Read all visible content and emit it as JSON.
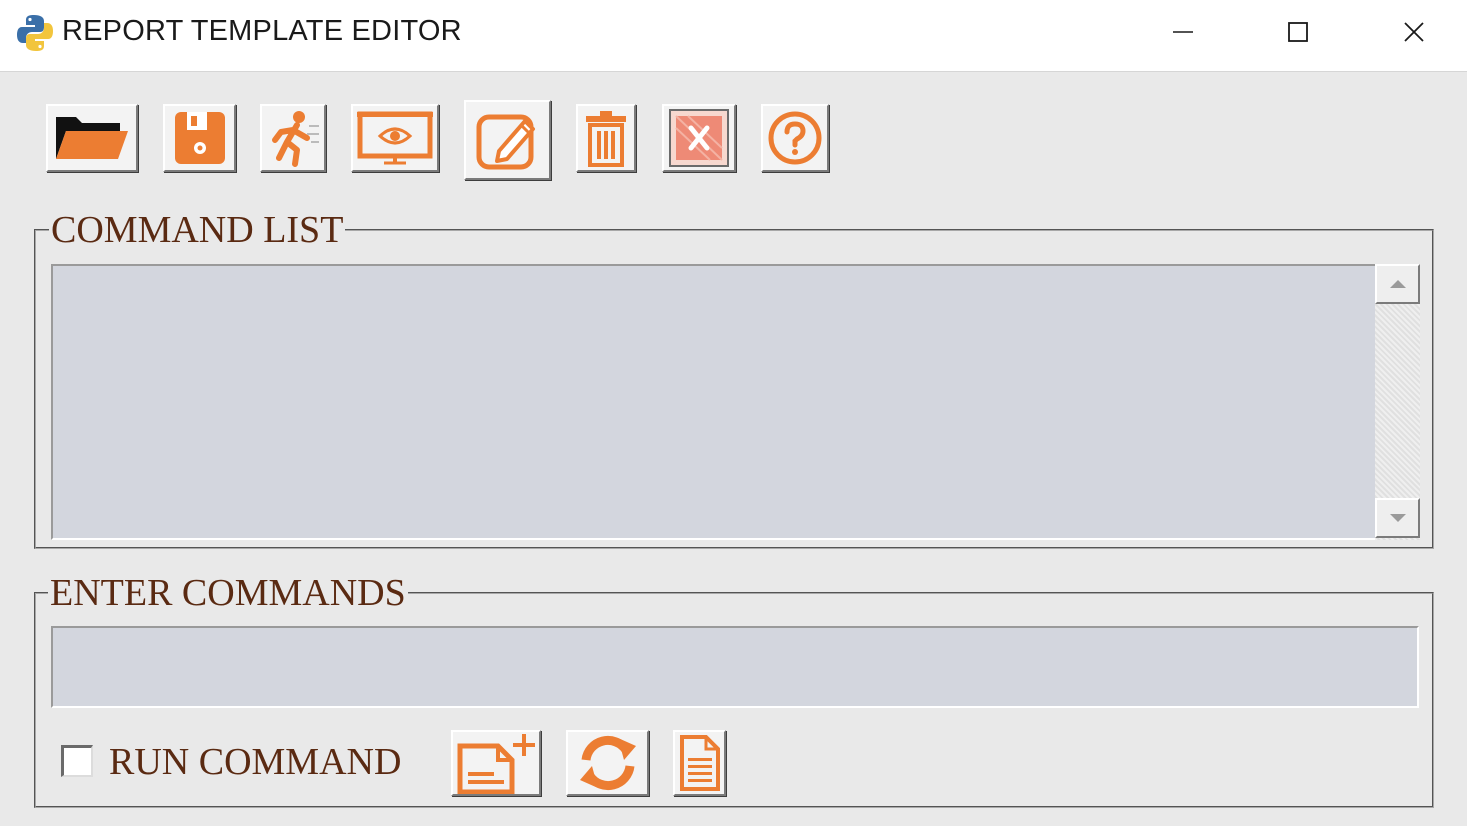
{
  "window": {
    "title": "REPORT TEMPLATE EDITOR",
    "controls": [
      "minimize",
      "maximize",
      "close"
    ]
  },
  "toolbar": {
    "buttons": [
      {
        "id": "open",
        "icon": "folder-open-icon"
      },
      {
        "id": "save",
        "icon": "floppy-disk-icon"
      },
      {
        "id": "run",
        "icon": "running-man-icon"
      },
      {
        "id": "preview",
        "icon": "screen-eye-icon"
      },
      {
        "id": "edit",
        "icon": "pencil-edit-icon"
      },
      {
        "id": "delete",
        "icon": "trash-can-icon"
      },
      {
        "id": "clear",
        "icon": "clear-x-icon"
      },
      {
        "id": "help",
        "icon": "question-mark-icon"
      }
    ]
  },
  "command_list": {
    "label": "COMMAND LIST",
    "items": []
  },
  "enter_commands": {
    "label": "ENTER COMMANDS",
    "value": "",
    "run_command_label": "RUN COMMAND",
    "run_command_checked": false,
    "buttons": [
      {
        "id": "add",
        "icon": "document-add-icon"
      },
      {
        "id": "refresh",
        "icon": "refresh-arrows-icon"
      },
      {
        "id": "view",
        "icon": "document-icon"
      }
    ]
  },
  "colors": {
    "accent": "#ec7d32",
    "input_bg": "#d3d6de",
    "label_text": "#5a2a12",
    "window_bg": "#e9e9e9"
  }
}
